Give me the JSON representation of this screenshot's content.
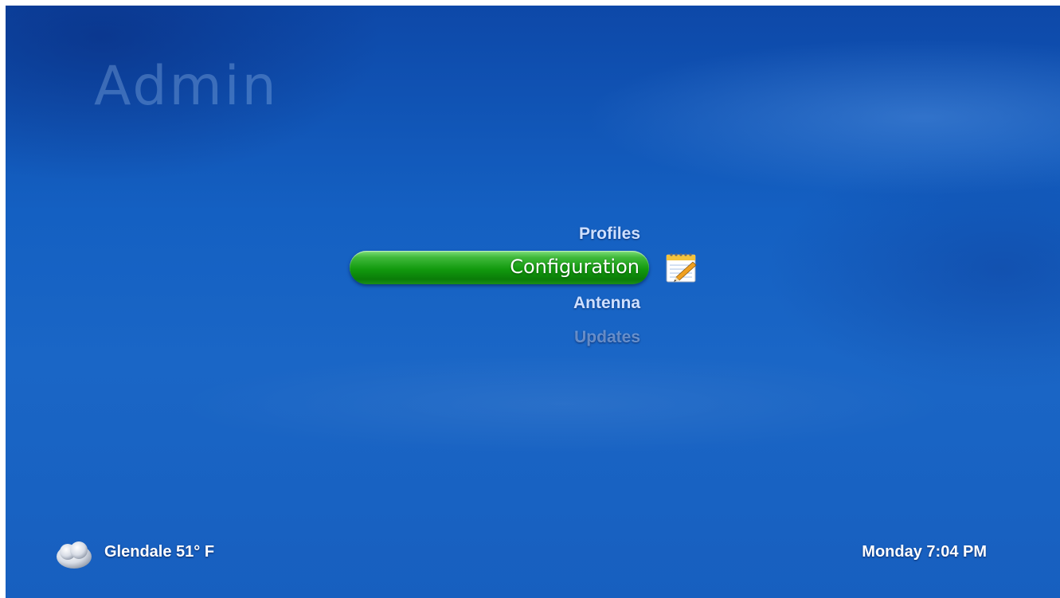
{
  "header": {
    "title": "Admin"
  },
  "menu": {
    "items": [
      {
        "label": "Profiles",
        "state": "normal"
      },
      {
        "label": "Configuration",
        "state": "selected",
        "icon": "notepad-pencil-icon"
      },
      {
        "label": "Antenna",
        "state": "normal"
      },
      {
        "label": "Updates",
        "state": "dimmed"
      }
    ]
  },
  "status": {
    "weather": {
      "icon": "cloudy-weather-icon",
      "text": "Glendale 51° F"
    },
    "clock": "Monday 7:04 PM"
  },
  "colors": {
    "background": "#1460c2",
    "selection_green": "#129a0e",
    "menu_text": "#cfe0ff"
  }
}
